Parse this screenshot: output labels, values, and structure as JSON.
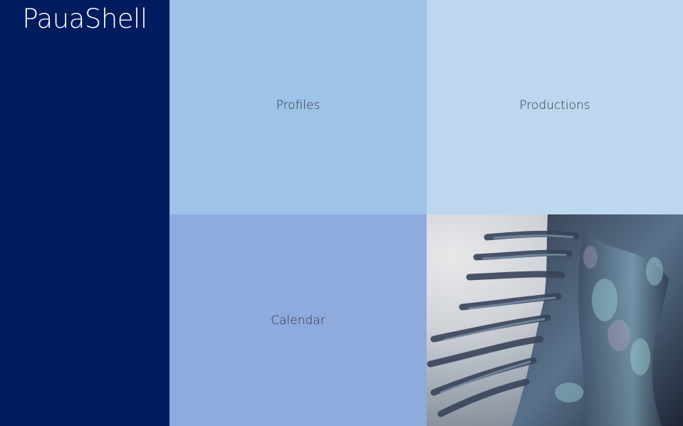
{
  "app": {
    "title": "PauaShell"
  },
  "tiles": [
    {
      "label": "Profiles",
      "color": "#9dc3e6"
    },
    {
      "label": "Productions",
      "color": "#bdd7ee"
    },
    {
      "label": "Calendar",
      "color": "#8faadc"
    }
  ],
  "image_tile": {
    "subject": "paua-shell-feather-sculpture-photo"
  },
  "colors": {
    "sidebar": "#001b5e",
    "brand_text": "#ffffff",
    "tile_text": "#2e3340"
  }
}
